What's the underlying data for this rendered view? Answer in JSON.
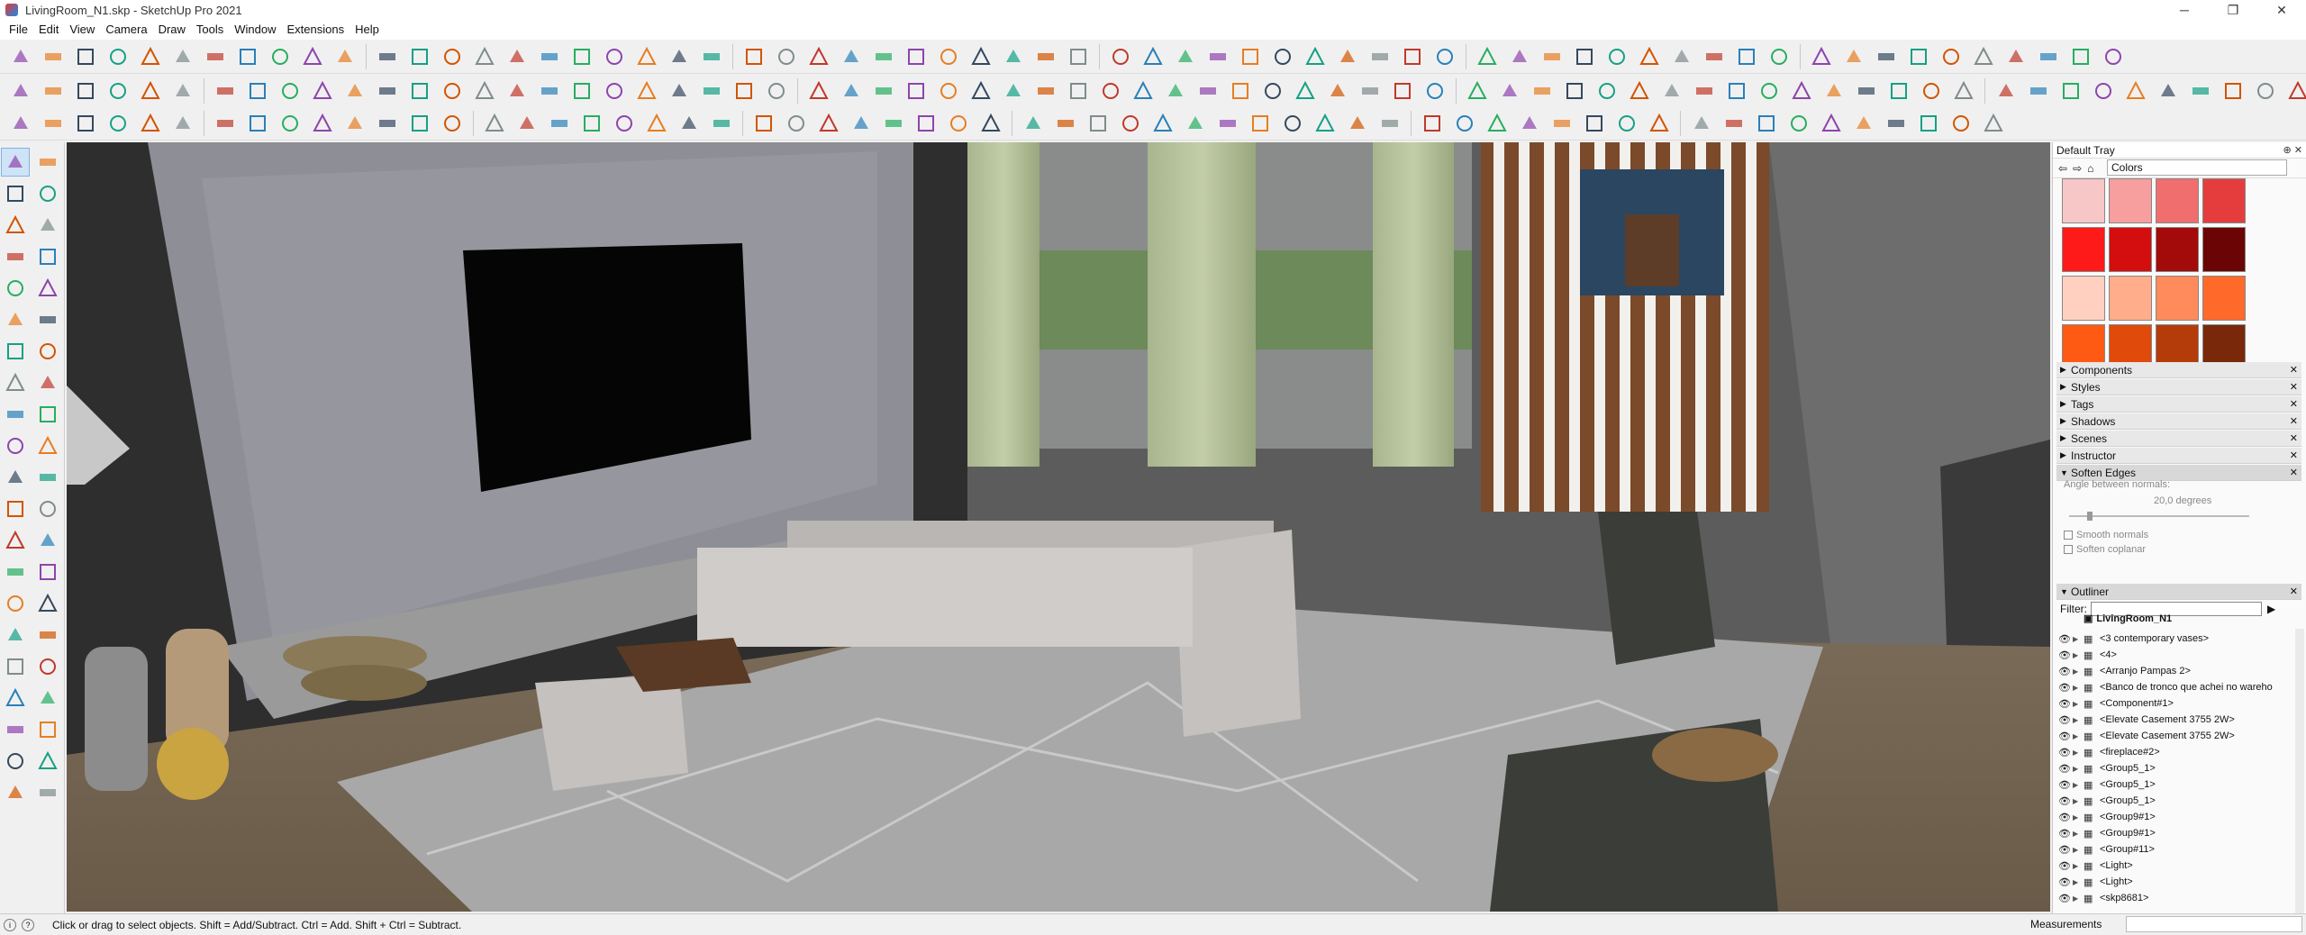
{
  "window": {
    "title": "LivingRoom_N1.skp - SketchUp Pro 2021",
    "minimize": "─",
    "maximize": "❐",
    "close": "✕"
  },
  "menu": [
    "File",
    "Edit",
    "View",
    "Camera",
    "Draw",
    "Tools",
    "Window",
    "Extensions",
    "Help"
  ],
  "tray": {
    "title": "Default Tray",
    "pin": "⊕ ✕",
    "colors_library": "Colors",
    "swatches": [
      "#f7c6c6",
      "#f79e9e",
      "#f06e6e",
      "#e53d3d",
      "#ff1a1a",
      "#d40e0e",
      "#a30a0a",
      "#6b0505",
      "#ffd0c0",
      "#ffad8a",
      "#ff8a5c",
      "#ff6a2a",
      "#ff5a14",
      "#e04a0a",
      "#b43c0a",
      "#7a280a"
    ],
    "panels": [
      {
        "name": "Components",
        "state": "closed"
      },
      {
        "name": "Styles",
        "state": "closed"
      },
      {
        "name": "Tags",
        "state": "closed"
      },
      {
        "name": "Shadows",
        "state": "closed"
      },
      {
        "name": "Scenes",
        "state": "closed"
      },
      {
        "name": "Instructor",
        "state": "closed"
      },
      {
        "name": "Soften Edges",
        "state": "open"
      }
    ],
    "soften": {
      "angle_label": "Angle between normals:",
      "angle_value": "20,0",
      "angle_unit": "degrees",
      "smooth_normals": "Smooth normals",
      "soften_coplanar": "Soften coplanar"
    },
    "outliner": {
      "title": "Outliner",
      "filter_label": "Filter:",
      "root": "LivingRoom_N1",
      "items": [
        "<3 contemporary vases>",
        "<4>",
        "<Arranjo Pampas 2>",
        "<Banco de tronco que achei no wareho",
        "<Component#1>",
        "<Elevate Casement 3755 2W>",
        "<Elevate Casement 3755 2W>",
        "<fireplace#2>",
        "<Group5_1>",
        "<Group5_1>",
        "<Group5_1>",
        "<Group9#1>",
        "<Group9#1>",
        "<Group#11>",
        "<Light>",
        "<Light>",
        "<skp8681>"
      ]
    }
  },
  "status": {
    "hint": "Click or drag to select objects. Shift = Add/Subtract. Ctrl = Add. Shift + Ctrl = Subtract.",
    "measurements_label": "Measurements"
  },
  "icons": {
    "eye": "👁",
    "expand": "▶",
    "component": "▦"
  }
}
